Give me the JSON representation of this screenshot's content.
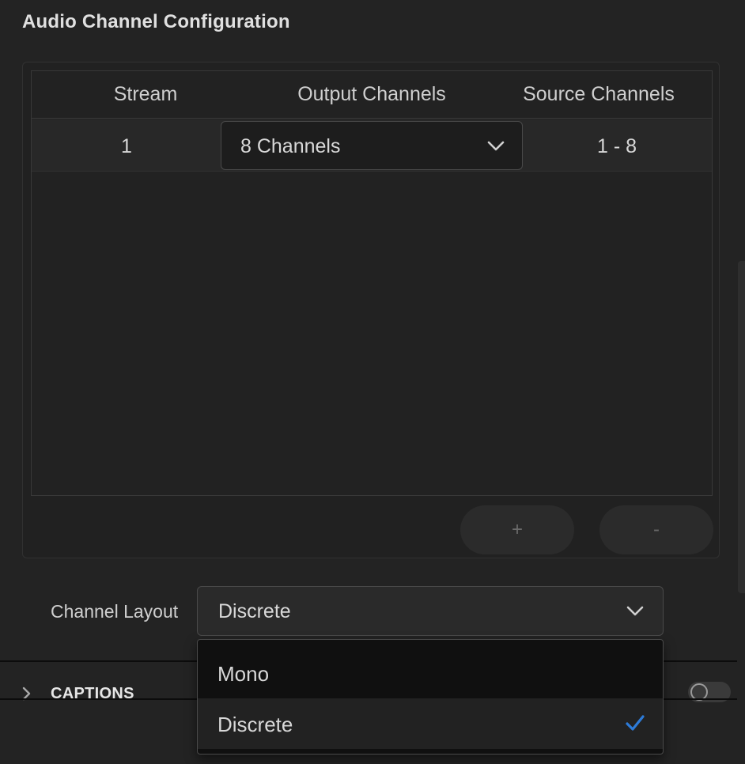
{
  "section": {
    "title": "Audio Channel Configuration"
  },
  "table": {
    "columns": [
      "Stream",
      "Output Channels",
      "Source Channels"
    ],
    "rows": [
      {
        "stream": "1",
        "output": "8 Channels",
        "source": "1 - 8"
      }
    ]
  },
  "buttons": {
    "add_label": "+",
    "remove_label": "-"
  },
  "channel_layout": {
    "label": "Channel Layout",
    "selected": "Discrete",
    "options": [
      "Mono",
      "Discrete"
    ]
  },
  "captions": {
    "label": "CAPTIONS",
    "enabled": false
  },
  "colors": {
    "background": "#232323",
    "check_accent": "#2d7bd8"
  },
  "icons": {
    "output_dropdown": "chevron-down-icon",
    "layout_dropdown": "chevron-down-icon",
    "captions_expand": "chevron-right-icon",
    "selected_option": "check-icon"
  }
}
